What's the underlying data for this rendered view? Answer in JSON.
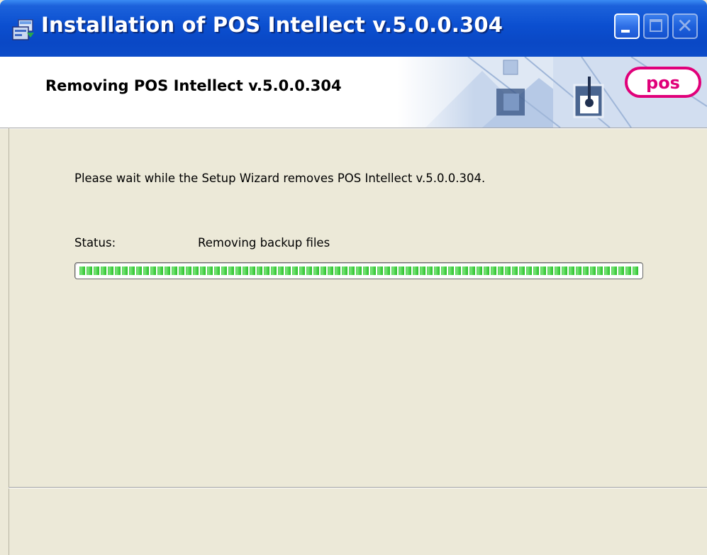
{
  "window": {
    "title": "Installation of POS Intellect v.5.0.0.304",
    "controls": [
      "minimize",
      "maximize",
      "close"
    ]
  },
  "header": {
    "title": "Removing POS Intellect v.5.0.0.304",
    "logo_text": "pos"
  },
  "body": {
    "description": "Please wait while the Setup Wizard removes POS Intellect v.5.0.0.304.",
    "status_label": "Status:",
    "status_value": "Removing backup files"
  },
  "progress": {
    "fraction": 1.0
  },
  "colors": {
    "titlebar": "#0b4fd0",
    "dialog_bg": "#ece9d8",
    "progress_green": "#3fcf3f",
    "logo_magenta": "#e0007a"
  }
}
